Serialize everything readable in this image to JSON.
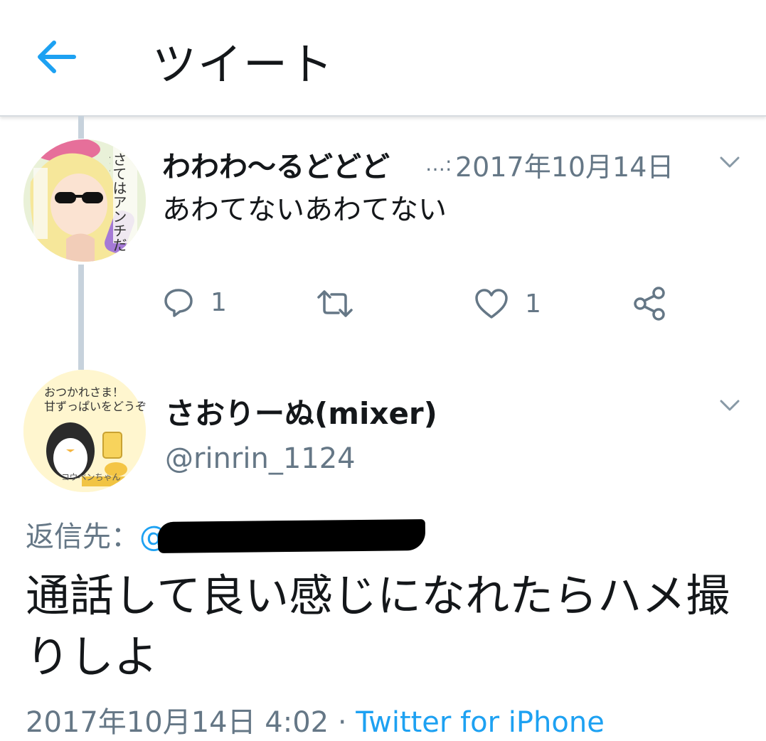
{
  "header": {
    "title": "ツイート",
    "back_icon": "arrow-left-icon"
  },
  "colors": {
    "accent": "#1da1f2",
    "muted": "#657786",
    "text": "#14171a",
    "thread_line": "#c7d2dc"
  },
  "parent_tweet": {
    "display_name": "わわわ〜るどどど",
    "ellipsis": "…:",
    "date": "2017年10月14日",
    "text": "あわてないあわてない",
    "avatar_text": "さてはアンチだなオメー",
    "actions": {
      "reply_count": "1",
      "like_count": "1"
    }
  },
  "main_tweet": {
    "display_name": "さおりーぬ(mixer)",
    "handle": "@rinrin_1124",
    "avatar_text_line1": "おつかれさま！",
    "avatar_text_line2": "甘ずっぱいをどうぞ",
    "avatar_caption": "コウペンちゃん",
    "reply_to_label": "返信先：",
    "reply_to_handle_prefix": "@",
    "text": "通話して良い感じになれたらハメ撮りしよ",
    "timestamp": "2017年10月14日 4:02",
    "separator": "·",
    "source": "Twitter for iPhone"
  }
}
